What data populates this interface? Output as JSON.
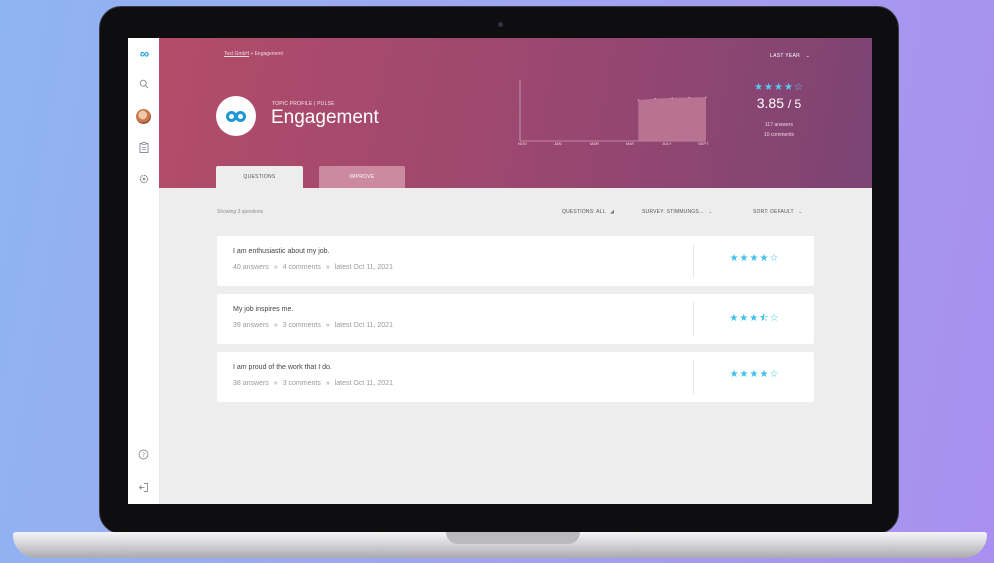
{
  "sidebar": {
    "logo_text": "∞",
    "icons": [
      "search-icon",
      "avatar",
      "clipboard-icon",
      "settings-icon",
      "help-icon",
      "logout-icon"
    ]
  },
  "breadcrumb": {
    "parent": "Test GmbH",
    "separator": "»",
    "current": "Engagement"
  },
  "topic": {
    "subtitle": "TOPIC PROFILE | PULSE",
    "title": "Engagement"
  },
  "period": {
    "label": "LAST YEAR"
  },
  "chart_data": {
    "type": "area",
    "x_ticks": [
      "NOV",
      "JAN",
      "MAR",
      "MAY",
      "JULY",
      "SEPT"
    ],
    "x": [
      0,
      1,
      2,
      3,
      4,
      5,
      6,
      7,
      8,
      9,
      10,
      11
    ],
    "values": [
      0,
      0,
      0,
      0,
      0,
      0,
      0,
      3.6,
      3.72,
      3.78,
      3.82,
      3.85
    ],
    "ylim": [
      0,
      5
    ],
    "title": "",
    "xlabel": "",
    "ylabel": "",
    "grid": false,
    "colors": {
      "fill": "#c07a98",
      "axis": "#e9c6d4"
    }
  },
  "summary": {
    "stars": "★★★★☆",
    "score": "3.85",
    "denominator": "/ 5",
    "answers": "117 answers",
    "comments": "10 comments"
  },
  "tabs": {
    "questions": "QUESTIONS",
    "improve": "IMPROVE"
  },
  "filters": {
    "showing": "Showing 3 questions",
    "questions": "QUESTIONS: ALL",
    "survey": "SURVEY: STIMMUNGS...",
    "sort": "SORT: DEFAULT"
  },
  "questions": [
    {
      "text": "I am enthusiastic about my job.",
      "answers": "40 answers",
      "comments": "4 comments",
      "latest": "latest Oct 11, 2021",
      "stars": "★★★★☆"
    },
    {
      "text": "My job inspires me.",
      "answers": "39 answers",
      "comments": "3 comments",
      "latest": "latest Oct 11, 2021",
      "stars": "★★★⯪☆"
    },
    {
      "text": "I am proud of the work that I do.",
      "answers": "38 answers",
      "comments": "3 comments",
      "latest": "latest Oct 11, 2021",
      "stars": "★★★★☆"
    }
  ],
  "meta_separator": "»",
  "colors": {
    "hero_start": "#b34c69",
    "hero_end": "#7c4473",
    "accent": "#1f97d4",
    "star": "#3fc0eb"
  }
}
